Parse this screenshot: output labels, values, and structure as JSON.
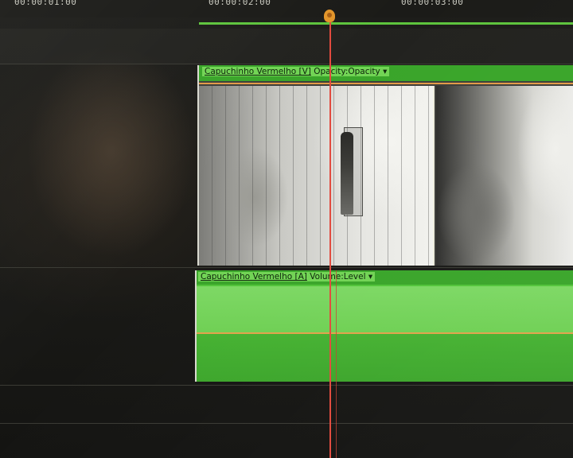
{
  "timeline": {
    "ruler": {
      "timecodes": [
        "00:00:01:00",
        "00:00:02:00",
        "00:00:03:00"
      ]
    },
    "video_track": {
      "clip_name": "Capuchinho Vermelho [V]",
      "effect_label": "Opacity:Opacity",
      "dropdown_glyph": "▾"
    },
    "audio_track": {
      "clip_name": "Capuchinho Vermelho [A]",
      "effect_label": "Volume:Level",
      "dropdown_glyph": "▾"
    }
  },
  "colors": {
    "clip_green": "#52c43a",
    "clip_header_green": "#3aa52a",
    "keyframe_line": "#e29a48",
    "playhead": "#e24a3e",
    "playhead_handle": "#e3952a"
  }
}
